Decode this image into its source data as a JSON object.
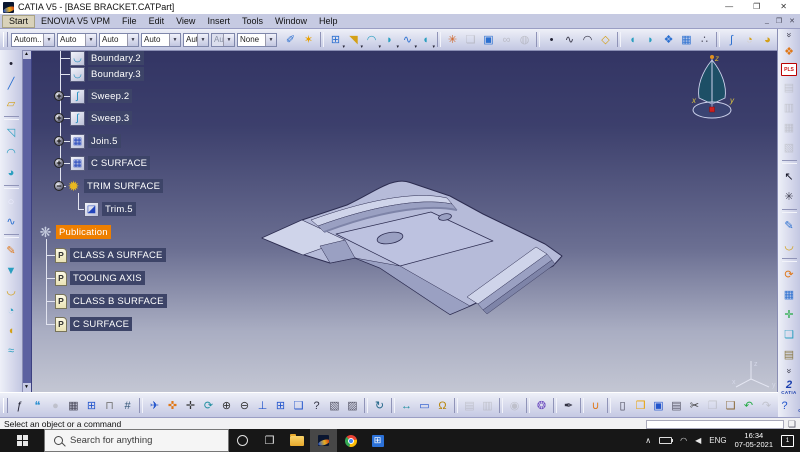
{
  "colors": {
    "vp-top": "#333564",
    "vp-bottom": "#c3c6d3",
    "part-fill": "#b6bbd9",
    "part-light": "#cfd4ea",
    "part-mid": "#9aa0c2",
    "part-dark": "#7e84a8",
    "part-outline": "#2c2c50",
    "tree-sel": "#3d4468",
    "tree-pub": "#ee7f00",
    "tb1": "#eef0f8",
    "tb2": "#c3c7e2",
    "taskbar": "#171717"
  },
  "titlebar": {
    "title": "CATIA V5 - [BASE BRACKET.CATPart]"
  },
  "window_controls": {
    "minimize": "—",
    "restore": "❐",
    "close": "✕",
    "mdi_minimize": "_",
    "mdi_restore": "❐",
    "mdi_close": "✕"
  },
  "menubar": {
    "items": [
      {
        "label": "Start",
        "highlight": true
      },
      {
        "label": "ENOVIA V5 VPM"
      },
      {
        "label": "File"
      },
      {
        "label": "Edit"
      },
      {
        "label": "View"
      },
      {
        "label": "Insert"
      },
      {
        "label": "Tools"
      },
      {
        "label": "Window"
      },
      {
        "label": "Help"
      }
    ]
  },
  "top_toolbar": {
    "dropdowns": [
      {
        "value": "Autom.."
      },
      {
        "value": "Auto"
      },
      {
        "value": "Auto"
      },
      {
        "value": "Auto"
      },
      {
        "value": "Aut"
      },
      {
        "value": "Aut",
        "disabled": true
      },
      {
        "value": "None"
      }
    ]
  },
  "toolbars": {
    "top": [
      {
        "n": "apply-material-icon",
        "g": "✐",
        "c": "#2a6fd0"
      },
      {
        "n": "graphic-wand-icon",
        "g": "✶",
        "c": "#e8a000"
      },
      {
        "n": "pattern-icon",
        "g": "⊞",
        "c": "#2a6fd0",
        "sep": true,
        "caret": true
      },
      {
        "n": "flag-icon",
        "g": "◥",
        "c": "#d4a017",
        "caret": true
      },
      {
        "n": "extrude-surface-icon",
        "g": "◠",
        "c": "#2a9fc0",
        "caret": true
      },
      {
        "n": "revolve-surface-icon",
        "g": "◗",
        "c": "#2a9fc0",
        "caret": true
      },
      {
        "n": "sweep-surface-icon",
        "g": "∿",
        "c": "#2a6fd0",
        "caret": true
      },
      {
        "n": "fill-surface-icon",
        "g": "◖",
        "c": "#2a9fc0",
        "caret": true
      },
      {
        "n": "macro-icon",
        "g": "✳",
        "c": "#d06020",
        "sep": true
      },
      {
        "n": "paper-icon",
        "g": "❏",
        "c": "#8890a8",
        "gray": true
      },
      {
        "n": "image-icon",
        "g": "▣",
        "c": "#2a6fd0"
      },
      {
        "n": "link-icon",
        "g": "∞",
        "c": "#8890a8",
        "gray": true
      },
      {
        "n": "powercopy-icon",
        "g": "◍",
        "c": "#8890a8",
        "gray": true
      },
      {
        "n": "point-icon",
        "g": "•",
        "c": "#223",
        "sep": true
      },
      {
        "n": "spline-icon",
        "g": "∿",
        "c": "#334"
      },
      {
        "n": "arc-icon",
        "g": "◠",
        "c": "#334"
      },
      {
        "n": "plane-icon",
        "g": "◇",
        "c": "#d4a017"
      },
      {
        "n": "shell-icon",
        "g": "◖",
        "c": "#2a9fc0",
        "sep": true
      },
      {
        "n": "thick-surface-icon",
        "g": "◗",
        "c": "#2a9fc0"
      },
      {
        "n": "sculpt-icon",
        "g": "❖",
        "c": "#2a6fd0"
      },
      {
        "n": "net-surface-icon",
        "g": "▦",
        "c": "#2a6fd0"
      },
      {
        "n": "cloud-points-icon",
        "g": "∴",
        "c": "#556"
      },
      {
        "n": "spline-surface-icon",
        "g": "∫",
        "c": "#2a6fd0",
        "sep": true
      },
      {
        "n": "fold-icon",
        "g": "◔",
        "c": "#d4a017"
      },
      {
        "n": "unfold-icon",
        "g": "◕",
        "c": "#d4a017"
      },
      {
        "n": "ruled-surface-icon",
        "g": "▰",
        "c": "#d4a017"
      },
      {
        "n": "spiral-icon",
        "g": "⟳",
        "c": "#2a9fc0",
        "sep": true
      }
    ],
    "left": [
      {
        "n": "point-tool-icon",
        "g": "•",
        "c": "#223"
      },
      {
        "n": "line-tool-icon",
        "g": "╱",
        "c": "#2a6fd0"
      },
      {
        "n": "plane-tool-icon",
        "g": "▱",
        "c": "#d4a017"
      },
      {
        "n": "extrude-tool-icon",
        "g": "◹",
        "c": "#2a9fc0",
        "sep": true
      },
      {
        "n": "revolve-tool-icon",
        "g": "◠",
        "c": "#2a9fc0"
      },
      {
        "n": "sphere-tool-icon",
        "g": "◕",
        "c": "#2a9fc0"
      },
      {
        "n": "circle-tool-icon",
        "g": "○",
        "c": "#eef",
        "sep": true
      },
      {
        "n": "spline-tool-icon",
        "g": "∿",
        "c": "#2a6fd0"
      },
      {
        "n": "sketch-tool-icon",
        "g": "✎",
        "c": "#e07818",
        "sep": true
      },
      {
        "n": "projection-tool-icon",
        "g": "▼",
        "c": "#2a9fc0"
      },
      {
        "n": "boundary-tool-icon",
        "g": "◡",
        "c": "#d4a017"
      },
      {
        "n": "extract-tool-icon",
        "g": "◔",
        "c": "#2a9fc0"
      },
      {
        "n": "fillet-tool-icon",
        "g": "◖",
        "c": "#d4a017"
      },
      {
        "n": "offset-tool-icon",
        "g": "≈",
        "c": "#2a9fc0"
      }
    ],
    "right": [
      {
        "n": "more-tools-chevron",
        "g": "»",
        "t": "chev"
      },
      {
        "n": "exit-workbench-icon",
        "g": "❖",
        "c": "#e07818"
      },
      {
        "n": "plm-access-icon",
        "g": "PLS",
        "t": "text",
        "c": "#c11"
      },
      {
        "n": "pdm-icon-1",
        "g": "▤",
        "c": "#99a0b8",
        "gray": true
      },
      {
        "n": "pdm-icon-2",
        "g": "▥",
        "c": "#99a0b8",
        "gray": true
      },
      {
        "n": "pdm-icon-3",
        "g": "▦",
        "c": "#99a0b8",
        "gray": true
      },
      {
        "n": "pdm-icon-4",
        "g": "▧",
        "c": "#99a0b8",
        "gray": true
      },
      {
        "n": "select-cursor-icon",
        "g": "↖",
        "c": "#112",
        "sep": true
      },
      {
        "n": "smart-pick-icon",
        "g": "✳",
        "c": "#445"
      },
      {
        "n": "sketcher-icon",
        "g": "✎",
        "c": "#2a6fd0",
        "sep": true
      },
      {
        "n": "profile-icon",
        "g": "◡",
        "c": "#d4a017"
      },
      {
        "n": "update-icon",
        "g": "⟳",
        "c": "#e07818",
        "sep": true
      },
      {
        "n": "grid-icon",
        "g": "▦",
        "c": "#2a6fd0"
      },
      {
        "n": "axis-system-icon",
        "g": "✛",
        "c": "#22aa44"
      },
      {
        "n": "insert-surface-icon",
        "g": "❏",
        "c": "#2a9fc0"
      },
      {
        "n": "layers-icon",
        "g": "▤",
        "c": "#887744"
      },
      {
        "n": "more-tools-chevron-2",
        "g": "»",
        "t": "chev"
      },
      {
        "n": "ds-catia-logo",
        "t": "logo"
      }
    ],
    "bottom": [
      {
        "n": "formula-icon",
        "g": "ƒ",
        "c": "#223"
      },
      {
        "n": "comment-icon",
        "g": "❝",
        "c": "#2a8fd0"
      },
      {
        "n": "knowledge-dot-icon",
        "g": "●",
        "c": "#99a",
        "gray": true
      },
      {
        "n": "check-analysis-icon",
        "g": "▦",
        "c": "#445"
      },
      {
        "n": "design-table-icon",
        "g": "⊞",
        "c": "#2255cc"
      },
      {
        "n": "lock-icon",
        "g": "⊓",
        "c": "#777"
      },
      {
        "n": "relations-icon",
        "g": "#",
        "c": "#357"
      },
      {
        "n": "fly-mode-icon",
        "g": "✈",
        "c": "#2255cc",
        "sep": true
      },
      {
        "n": "fit-all-in-icon",
        "g": "✜",
        "c": "#e07818"
      },
      {
        "n": "pan-icon",
        "g": "✛",
        "c": "#333"
      },
      {
        "n": "rotate-icon",
        "g": "⟳",
        "c": "#1f8fa0"
      },
      {
        "n": "zoom-in-icon",
        "g": "⊕",
        "c": "#333"
      },
      {
        "n": "zoom-out-icon",
        "g": "⊖",
        "c": "#333"
      },
      {
        "n": "normal-view-icon",
        "g": "⊥",
        "c": "#2255cc"
      },
      {
        "n": "multi-view-icon",
        "g": "⊞",
        "c": "#2255cc"
      },
      {
        "n": "iso-view-icon",
        "g": "❑",
        "c": "#2255cc"
      },
      {
        "n": "quick-view-icon",
        "g": "?",
        "c": "#334"
      },
      {
        "n": "shaded-view-icon",
        "g": "▧",
        "c": "#556"
      },
      {
        "n": "wireframe-view-icon",
        "g": "▨",
        "c": "#556"
      },
      {
        "n": "rotate-screen-icon",
        "g": "↻",
        "c": "#268",
        "sep": true
      },
      {
        "n": "measure-between-icon",
        "g": "↔",
        "c": "#1f8fa0",
        "sep": true
      },
      {
        "n": "measure-item-icon",
        "g": "▭",
        "c": "#2255cc"
      },
      {
        "n": "inertia-icon",
        "g": "Ω",
        "c": "#b8860b"
      },
      {
        "n": "grayed-icon-1",
        "g": "▤",
        "c": "#99a",
        "gray": true,
        "sep": true
      },
      {
        "n": "grayed-icon-2",
        "g": "▥",
        "c": "#99a",
        "gray": true
      },
      {
        "n": "mouse-settings-icon",
        "g": "◉",
        "c": "#99a",
        "gray": true,
        "sep": true
      },
      {
        "n": "catalog-browser-icon",
        "g": "❂",
        "c": "#7050c0",
        "sep": true
      },
      {
        "n": "painter-icon",
        "g": "✒",
        "c": "#334",
        "sep": true
      },
      {
        "n": "basket-icon",
        "g": "∪",
        "c": "#e07818",
        "sep": true
      },
      {
        "n": "new-document-icon",
        "g": "▯",
        "c": "#445",
        "sep": true
      },
      {
        "n": "open-icon",
        "g": "❒",
        "c": "#e8a000"
      },
      {
        "n": "save-icon",
        "g": "▣",
        "c": "#2255cc"
      },
      {
        "n": "print-icon",
        "g": "▤",
        "c": "#556"
      },
      {
        "n": "cut-icon",
        "g": "✂",
        "c": "#333"
      },
      {
        "n": "copy-icon",
        "g": "❐",
        "c": "#99a",
        "gray": true
      },
      {
        "n": "paste-icon",
        "g": "❑",
        "c": "#886633"
      },
      {
        "n": "undo-icon",
        "g": "↶",
        "c": "#22aa44"
      },
      {
        "n": "redo-icon",
        "g": "↷",
        "c": "#99a",
        "gray": true
      },
      {
        "n": "whats-this-icon",
        "g": "?",
        "c": "#2255cc"
      },
      {
        "n": "ds-catia-logo-2",
        "t": "logo"
      }
    ]
  },
  "tree": {
    "icon_glyphs": {
      "boundary": {
        "g": "◡",
        "c": "#1f8fc0"
      },
      "sweep": {
        "g": "∫",
        "c": "#1f8fc0"
      },
      "join": {
        "g": "▦",
        "c": "#2244bb"
      },
      "trim": {
        "g": "◪",
        "c": "#2244bb"
      },
      "openbody": {
        "g": "✹",
        "c": "#e8b820"
      },
      "publication": {
        "g": "❋",
        "c": "#c8cee0"
      },
      "pubitem": {
        "g": "P",
        "c": "#333333"
      }
    },
    "items": [
      {
        "label": "Boundary.2",
        "icon": "boundary",
        "indent": "a"
      },
      {
        "label": "Boundary.3",
        "icon": "boundary",
        "indent": "a"
      },
      {
        "label": "Sweep.2",
        "icon": "sweep",
        "indent": "a",
        "exp": "+"
      },
      {
        "label": "Sweep.3",
        "icon": "sweep",
        "indent": "a",
        "exp": "+"
      },
      {
        "label": "Join.5",
        "icon": "join",
        "indent": "a",
        "exp": "+"
      },
      {
        "label": "C SURFACE",
        "icon": "join",
        "indent": "a",
        "exp": "+"
      },
      {
        "label": "TRIM SURFACE",
        "icon": "openbody",
        "indent": "trim",
        "exp": "−"
      },
      {
        "label": "Trim.5",
        "icon": "trim",
        "indent": "trim5"
      },
      {
        "label": "Publication",
        "icon": "publication",
        "indent": "pub",
        "highlight": "orange"
      },
      {
        "label": "CLASS A SURFACE",
        "icon": "pubitem",
        "indent": "pubc"
      },
      {
        "label": "TOOLING AXIS",
        "icon": "pubitem",
        "indent": "pubc"
      },
      {
        "label": "CLASS B SURFACE",
        "icon": "pubitem",
        "indent": "pubc"
      },
      {
        "label": "C SURFACE",
        "icon": "pubitem",
        "indent": "pubc"
      }
    ]
  },
  "compass": {
    "x": "x",
    "y": "y",
    "z": "z"
  },
  "triad": {
    "x": "x",
    "y": "y",
    "z": "z"
  },
  "statusbar": {
    "message": "Select an object or a command"
  },
  "taskbar": {
    "search_placeholder": "Search for anything",
    "tray": {
      "lang": "ENG",
      "time": "16:34",
      "date": "07-05-2021",
      "badge": "1"
    }
  },
  "ds_logo": {
    "numeral": "2",
    "text": "CATIA"
  },
  "icons": {
    "combo_arrow": "▼",
    "caret": "▾",
    "scroll_up": "▲",
    "scroll_down": "▼",
    "task_view": "❐",
    "app_window": "⊞",
    "tray_chevron": "∧",
    "wifi": "◠",
    "speaker": "◀",
    "status_icon": "❏"
  }
}
